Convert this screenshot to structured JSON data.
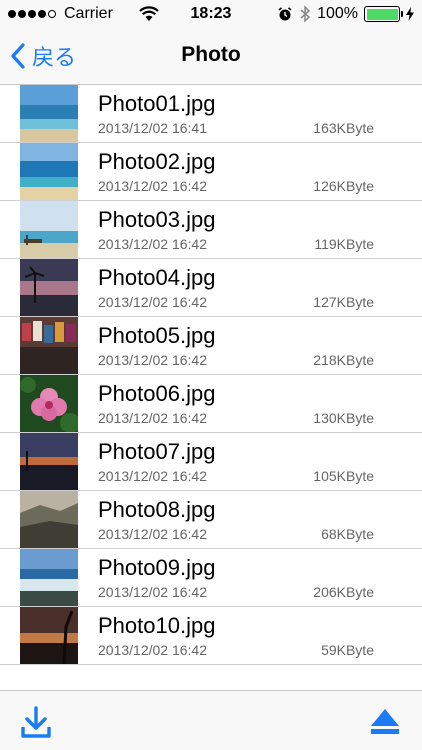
{
  "status_bar": {
    "carrier": "Carrier",
    "time": "18:23",
    "battery": "100%",
    "battery_level": 1.0,
    "icons": [
      "signal-dots",
      "wifi-icon",
      "alarm-icon",
      "bluetooth-icon",
      "battery-icon",
      "charging-bolt-icon"
    ]
  },
  "nav": {
    "back_label": "戻る",
    "title": "Photo"
  },
  "photos": [
    {
      "name": "Photo01.jpg",
      "date": "2013/12/02 16:41",
      "size": "163KByte"
    },
    {
      "name": "Photo02.jpg",
      "date": "2013/12/02 16:42",
      "size": "126KByte"
    },
    {
      "name": "Photo03.jpg",
      "date": "2013/12/02 16:42",
      "size": "119KByte"
    },
    {
      "name": "Photo04.jpg",
      "date": "2013/12/02 16:42",
      "size": "127KByte"
    },
    {
      "name": "Photo05.jpg",
      "date": "2013/12/02 16:42",
      "size": "218KByte"
    },
    {
      "name": "Photo06.jpg",
      "date": "2013/12/02 16:42",
      "size": "130KByte"
    },
    {
      "name": "Photo07.jpg",
      "date": "2013/12/02 16:42",
      "size": "105KByte"
    },
    {
      "name": "Photo08.jpg",
      "date": "2013/12/02 16:42",
      "size": "68KByte"
    },
    {
      "name": "Photo09.jpg",
      "date": "2013/12/02 16:42",
      "size": "206KByte"
    },
    {
      "name": "Photo10.jpg",
      "date": "2013/12/02 16:42",
      "size": "59KByte"
    }
  ],
  "toolbar": {
    "left_icon": "download-icon",
    "right_icon": "eject-icon"
  },
  "colors": {
    "accent": "#1a7cf5",
    "battery_fill": "#4cd964"
  }
}
